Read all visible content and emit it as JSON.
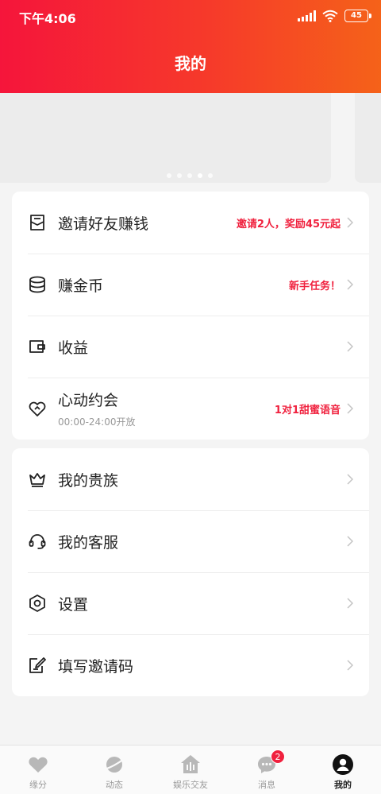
{
  "status_bar": {
    "time": "下午4:06",
    "battery": "45"
  },
  "header": {
    "title": "我的"
  },
  "banner": {
    "dot_count": 5,
    "active_dot": 3
  },
  "menu_group_1": [
    {
      "icon": "envelope-icon",
      "label": "邀请好友赚钱",
      "hint": "邀请2人，奖励45元起"
    },
    {
      "icon": "coin-stack-icon",
      "label": "赚金币",
      "hint": "新手任务！"
    },
    {
      "icon": "wallet-icon",
      "label": "收益",
      "hint": ""
    },
    {
      "icon": "heart-link-icon",
      "label": "心动约会",
      "sub": "00:00-24:00开放",
      "hint": "1对1甜蜜语音"
    }
  ],
  "menu_group_2": [
    {
      "icon": "crown-icon",
      "label": "我的贵族"
    },
    {
      "icon": "headset-icon",
      "label": "我的客服"
    },
    {
      "icon": "hexagon-gear-icon",
      "label": "设置"
    },
    {
      "icon": "edit-note-icon",
      "label": "填写邀请码"
    }
  ],
  "tabs": [
    {
      "icon": "heart-icon",
      "label": "缘分"
    },
    {
      "icon": "planet-icon",
      "label": "动态"
    },
    {
      "icon": "voice-house-icon",
      "label": "娱乐交友"
    },
    {
      "icon": "chat-bubble-icon",
      "label": "消息",
      "badge": "2"
    },
    {
      "icon": "profile-icon",
      "label": "我的"
    }
  ],
  "colors": {
    "accent": "#f0213e",
    "header_start": "#f5153b",
    "header_end": "#f56219"
  }
}
